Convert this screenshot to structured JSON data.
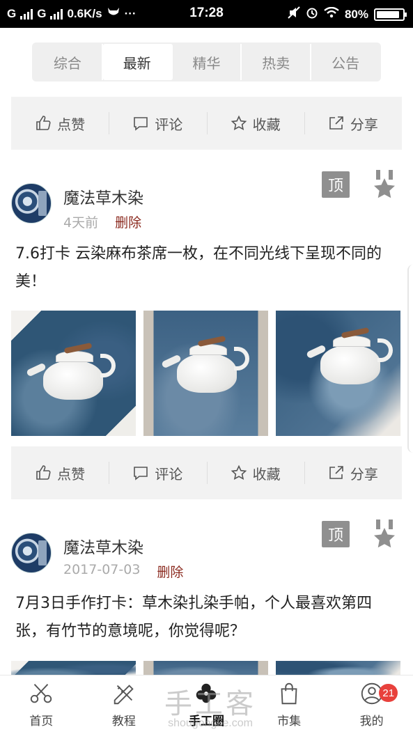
{
  "status_bar": {
    "carrier_left": "G",
    "carrier_right": "G",
    "net_speed": "0.6K/s",
    "dots": "···",
    "time": "17:28",
    "battery": "80%"
  },
  "tabs": [
    {
      "label": "综合",
      "active": false
    },
    {
      "label": "最新",
      "active": true
    },
    {
      "label": "精华",
      "active": false
    },
    {
      "label": "热卖",
      "active": false
    },
    {
      "label": "公告",
      "active": false
    }
  ],
  "actions": {
    "like": "点赞",
    "comment": "评论",
    "favorite": "收藏",
    "share": "分享"
  },
  "posts": [
    {
      "username": "魔法草木染",
      "time": "4天前",
      "delete": "删除",
      "top_badge": "顶",
      "text": "7.6打卡 云染麻布茶席一枚，在不同光线下呈现不同的美！"
    },
    {
      "username": "魔法草木染",
      "time": "2017-07-03",
      "delete": "删除",
      "top_badge": "顶",
      "text": "7月3日手作打卡：草木染扎染手帕，个人最喜欢第四张，有竹节的意境呢，你觉得呢？"
    }
  ],
  "watermark": {
    "line1": "手工客",
    "line2": "shougongke.com"
  },
  "bottom_nav": [
    {
      "label": "首页",
      "icon": "scissors-icon"
    },
    {
      "label": "教程",
      "icon": "pencil-ruler-icon"
    },
    {
      "label": "手工圈",
      "icon": "flower-icon",
      "active": true
    },
    {
      "label": "市集",
      "icon": "shopping-bag-icon"
    },
    {
      "label": "我的",
      "icon": "user-icon",
      "badge": "21"
    }
  ],
  "colors": {
    "delete_text": "#8b2a1f",
    "badge_red": "#e8413c",
    "action_bar_bg": "#f2f2f2"
  }
}
